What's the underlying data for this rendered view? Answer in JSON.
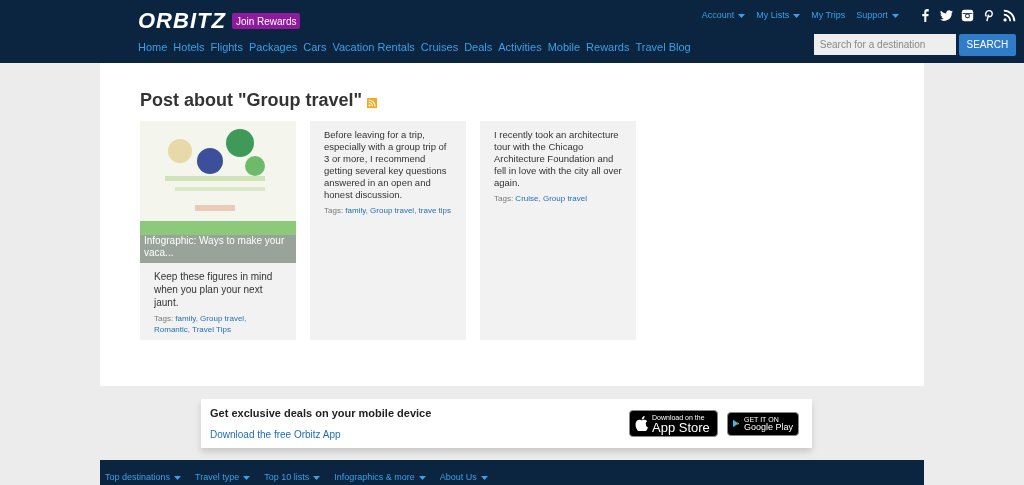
{
  "header": {
    "logo": "ORBITZ",
    "rewards_button": "Join Rewards",
    "top_links": [
      {
        "label": "Account",
        "dropdown": true
      },
      {
        "label": "My Lists",
        "dropdown": true
      },
      {
        "label": "My Trips",
        "dropdown": false
      },
      {
        "label": "Support",
        "dropdown": true
      }
    ],
    "social": [
      {
        "kind": "facebook"
      },
      {
        "kind": "twitter"
      },
      {
        "kind": "instagram"
      },
      {
        "kind": "pinterest"
      },
      {
        "kind": "rss"
      }
    ],
    "nav": [
      "Home",
      "Hotels",
      "Flights",
      "Packages",
      "Cars",
      "Vacation Rentals",
      "Cruises",
      "Deals",
      "Activities",
      "Mobile",
      "Rewards",
      "Travel Blog"
    ],
    "search": {
      "placeholder": "Search for a destination",
      "button": "SEARCH"
    }
  },
  "page_title": "Post about \"Group travel\"",
  "posts": [
    {
      "caption": "Infographic: Ways to make your vaca...",
      "summary": "Keep these figures in mind when you plan your next jaunt.",
      "tags_label": "Tags:",
      "tag_separator": ",",
      "tags": [
        "family",
        "Group travel",
        "Romantic",
        "Travel Tips"
      ]
    },
    {
      "kind": "text",
      "summary": "Before leaving for a trip, especially with a group trip of 3 or more, I recommend getting several key questions answered in an open and honest discussion.",
      "tags_label": "Tags:",
      "tag_separator": ",",
      "tags": [
        "family",
        "Group travel",
        "trave tips"
      ]
    },
    {
      "kind": "text",
      "summary": "I recently took an architecture tour with the Chicago Architecture Foundation and fell in love with the city all over again.",
      "tags_label": "Tags:",
      "tag_separator": ",",
      "tags": [
        "Cruise",
        "Group travel"
      ]
    }
  ],
  "app_banner": {
    "title": "Get exclusive deals on your mobile device",
    "link": "Download the free Orbitz App",
    "badges": [
      {
        "kind": "apple",
        "small": "Download on the",
        "big": "App Store"
      },
      {
        "kind": "google",
        "small": "GET IT ON",
        "big": "Google Play"
      }
    ]
  },
  "footer_links": [
    "Top destinations",
    "Travel type",
    "Top 10 lists",
    "Infographics & more",
    "About Us"
  ]
}
